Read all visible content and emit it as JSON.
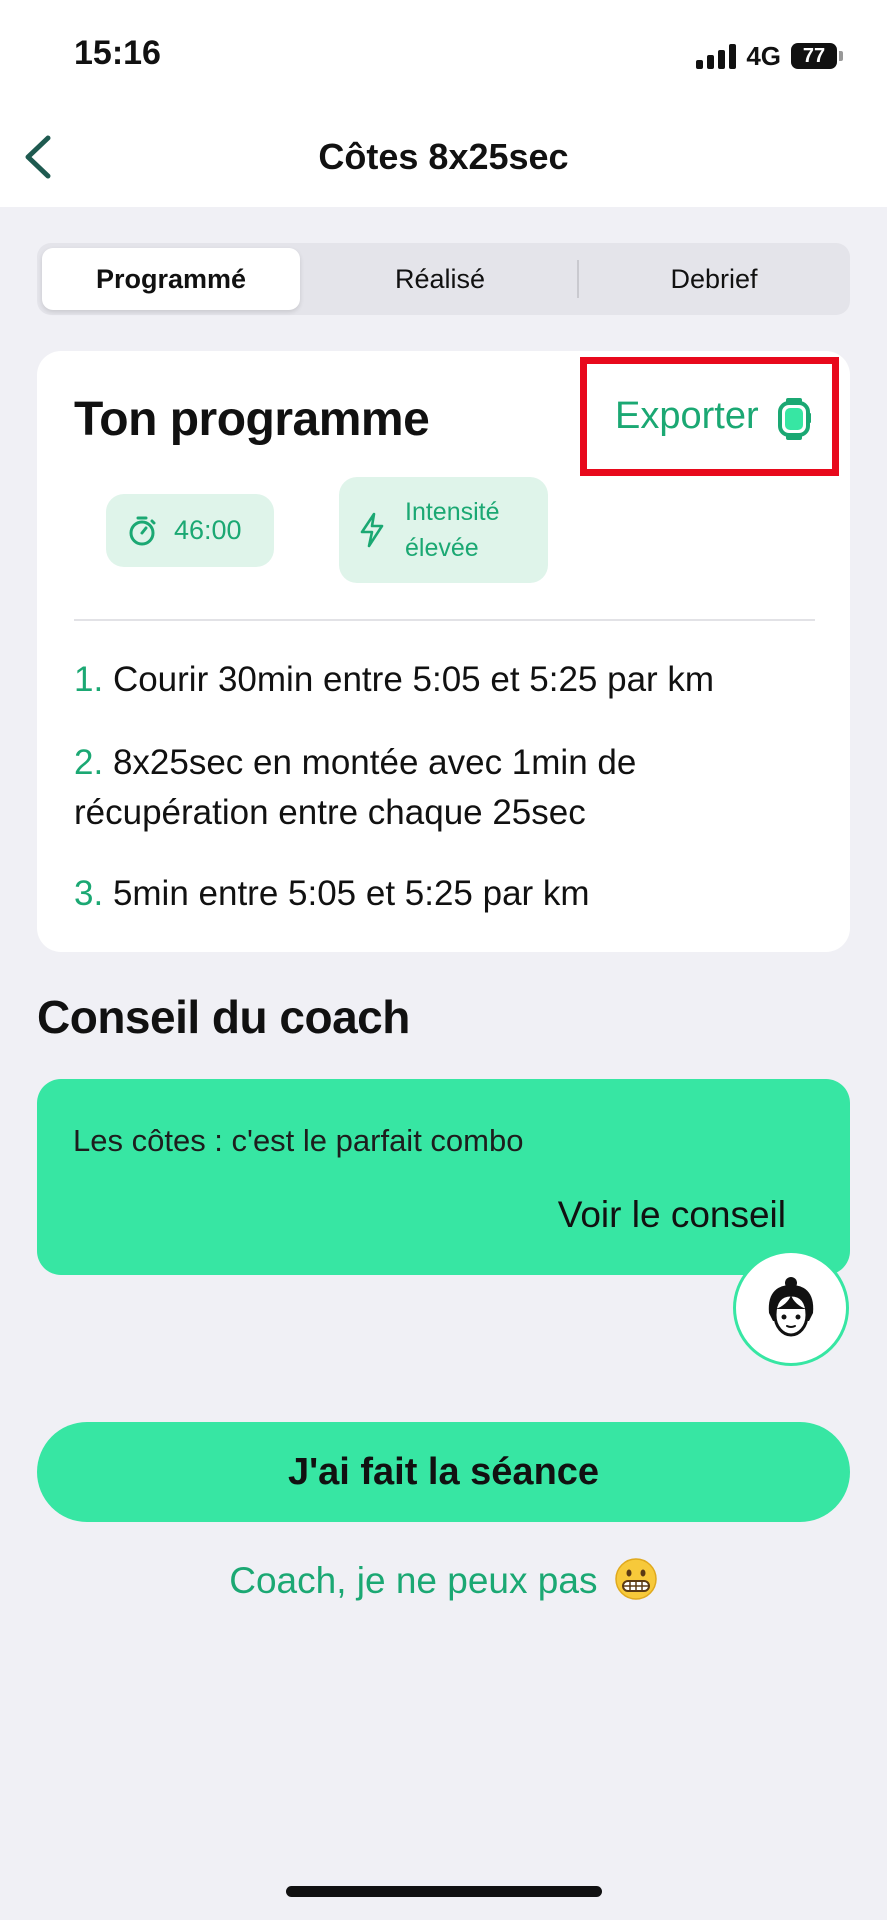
{
  "status_bar": {
    "time": "15:16",
    "network": "4G",
    "battery": "77"
  },
  "header": {
    "title": "Côtes 8x25sec",
    "back_icon": "chevron-left-icon"
  },
  "tabs": [
    {
      "label": "Programmé",
      "active": true
    },
    {
      "label": "Réalisé",
      "active": false
    },
    {
      "label": "Debrief",
      "active": false
    }
  ],
  "program": {
    "title": "Ton programme",
    "export_label": "Exporter",
    "export_icon": "smartwatch-icon",
    "duration": "46:00",
    "duration_icon": "stopwatch-icon",
    "intensity_line1": "Intensité",
    "intensity_line2": "élevée",
    "intensity_icon": "lightning-icon",
    "steps": [
      {
        "num": "1.",
        "text": "Courir 30min entre 5:05 et 5:25 par km"
      },
      {
        "num": "2.",
        "text": "8x25sec en montée avec 1min de récupération entre chaque 25sec"
      },
      {
        "num": "3.",
        "text": "5min entre 5:05 et 5:25 par km"
      }
    ]
  },
  "coach": {
    "section_title": "Conseil du coach",
    "advice_text": "Les côtes : c'est le parfait combo",
    "advice_link": "Voir le conseil",
    "avatar_icon": "coach-avatar-icon"
  },
  "actions": {
    "done_label": "J'ai fait la séance",
    "cant_label": "Coach, je ne peux pas",
    "cant_emoji": "grimacing-face-icon"
  },
  "colors": {
    "accent": "#37e6a3",
    "accent_text": "#1ba873",
    "highlight": "#e8091c",
    "background": "#f0f0f5"
  }
}
